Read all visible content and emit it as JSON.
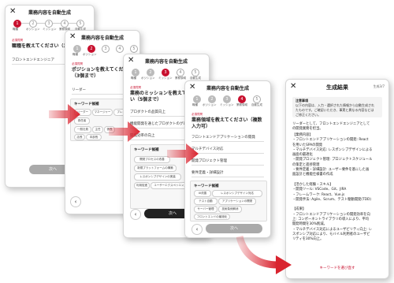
{
  "modal_title": "業務内容を自動生成",
  "step_labels": [
    "職種",
    "ポジション",
    "ミッション",
    "業務領域",
    "自動生成"
  ],
  "required": "必須質問",
  "screen1": {
    "question": "職種を教えてください（3個まで）",
    "answer": "フロントエンドエンジニア",
    "next": "次へ"
  },
  "screen2": {
    "question": "ポジションを教えてください（3個まで）",
    "answer": "リーダー",
    "keywords_title": "キーワード候補",
    "chips": [
      "リーダー",
      "マネージャー",
      "プレイヤー",
      "責任者",
      "一般社員",
      "主任",
      "係長",
      "店長",
      "本部長"
    ]
  },
  "screen3": {
    "question": "業務のミッションを教えてください（5個まで）",
    "lines": [
      "プロダクトの品質向上",
      "機能開発を通じたプロダクトのグロース",
      "開発効率の向上"
    ],
    "keywords_title": "キーワード候補",
    "chips": [
      "開発プロセスの改善",
      "新規プラットフォームの構築",
      "レスポンシブデザインの実装",
      "利用促進",
      "ユーザーエクスペリエンス"
    ],
    "next": "次へ"
  },
  "screen4": {
    "question": "業務領域を教えてください（複数入力可）",
    "lines": [
      "フロントエンドアプリケーションの開発",
      "マルチデバイス対応",
      "開発プロジェクト管理",
      "要件定義・詳細設計"
    ],
    "keywords_title": "キーワード候補",
    "chips": [
      "UI改善",
      "レスポンシブデザイン対応",
      "テスト自動",
      "アプリケーションの開発",
      "サーバー管理",
      "技術負債解消",
      "フロントエンドの最適化"
    ],
    "next": "次へ"
  },
  "screen5": {
    "title": "生成結果",
    "counter": "生成3/7",
    "note_title": "注意事項",
    "note": "以下の内容は、入力・選択された情報から自動生成され\nたものです。ご確認いただき、事実と異なる内容などは\nご修正ください。",
    "intro": "リーダーとして、フロントエンドエンジニアとして\nの開発業務を担当。",
    "body": "【業務内容】\n・フロントエンドアプリケーションの開発: React\nを用いたSPAの開発\n・マルチデバイス対応: レスポンシブデザインによる\n画面の最適化\n・開発プロジェクト管理: プロジェクトスケジュール\nの策定と進捗管理\n・要件定義・詳細設計: ユーザー要件を基にした画\n面設計と機能仕様書の作成\n\n【活かした経験・スキル】\n・開発ツール: VSCode、Git、JIRA\n・フレームワーク: React、Vue.js\n・開発手法: Agile、Scrum、テスト駆動開発(TDD)\n\n【成果】\n・フロントエンドアプリケーションの開発効率を向\n上: コンポーネントライブラリの導入により、平均\n開発時間を30%削減。\n・マルチデバイス対応によるユーザビリティ向上: レ\nスポンシブ対応により、モバイル利用者のユーザビ\nリティを30%向上。",
    "link": "キーワードを選び直す"
  },
  "colors": {
    "accent": "#c8102e",
    "arrow": "#d9242f"
  }
}
